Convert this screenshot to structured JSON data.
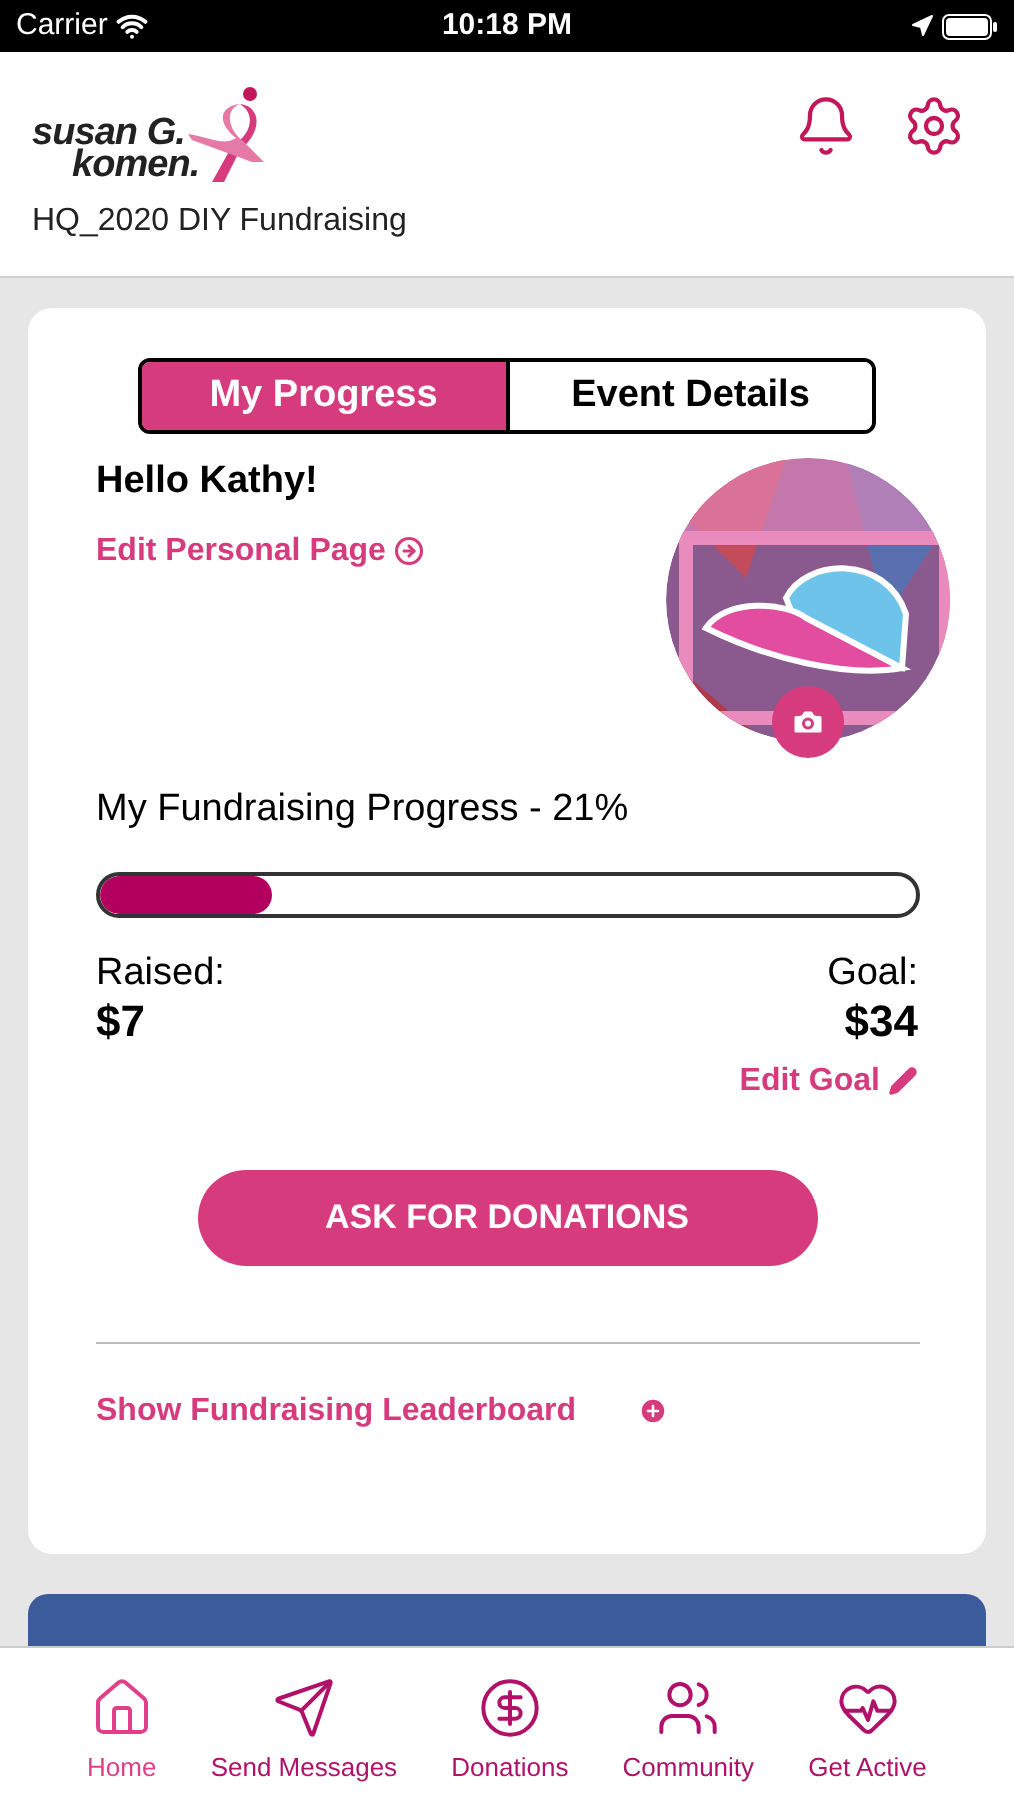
{
  "status_bar": {
    "carrier": "Carrier",
    "time": "10:18 PM"
  },
  "header": {
    "logo_line1": "susan G.",
    "logo_line2": "komen.",
    "subtitle": "HQ_2020 DIY Fundraising"
  },
  "tabs": [
    {
      "label": "My Progress",
      "selected": true
    },
    {
      "label": "Event Details",
      "selected": false
    }
  ],
  "greeting": "Hello Kathy!",
  "edit_page_link": "Edit Personal Page",
  "progress": {
    "title": "My Fundraising Progress - 21%",
    "level": 0.21,
    "raised_label": "Raised:",
    "raised": "$7",
    "goal_label": "Goal:",
    "goal": "$34",
    "edit_goal": "Edit Goal"
  },
  "ask_button": "ASK FOR DONATIONS",
  "leaderboard_link": "Show Fundraising Leaderboard",
  "bottom_nav": [
    {
      "label": "Home",
      "kind": "home",
      "selected": true
    },
    {
      "label": "Send Messages",
      "kind": "send",
      "selected": false
    },
    {
      "label": "Donations",
      "kind": "dollar",
      "selected": false
    },
    {
      "label": "Community",
      "kind": "users",
      "selected": false
    },
    {
      "label": "Get Active",
      "kind": "heart",
      "selected": false
    }
  ]
}
